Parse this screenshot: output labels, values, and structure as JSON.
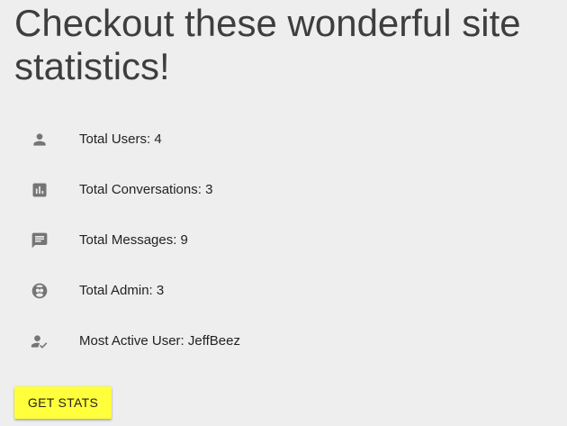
{
  "page": {
    "title": "Checkout these wonderful site statistics!"
  },
  "stats": {
    "items": [
      {
        "icon": "person-icon",
        "label": "Total Users: 4"
      },
      {
        "icon": "bar-chart-icon",
        "label": "Total Conversations: 3"
      },
      {
        "icon": "message-icon",
        "label": "Total Messages: 9"
      },
      {
        "icon": "face-icon",
        "label": "Total Admin: 3"
      },
      {
        "icon": "how-to-reg-icon",
        "label": "Most Active User: JeffBeez"
      }
    ]
  },
  "actions": {
    "get_stats_label": "GET STATS"
  },
  "colors": {
    "background": "#eeeeee",
    "icon": "#757575",
    "button": "#ffff3b"
  }
}
